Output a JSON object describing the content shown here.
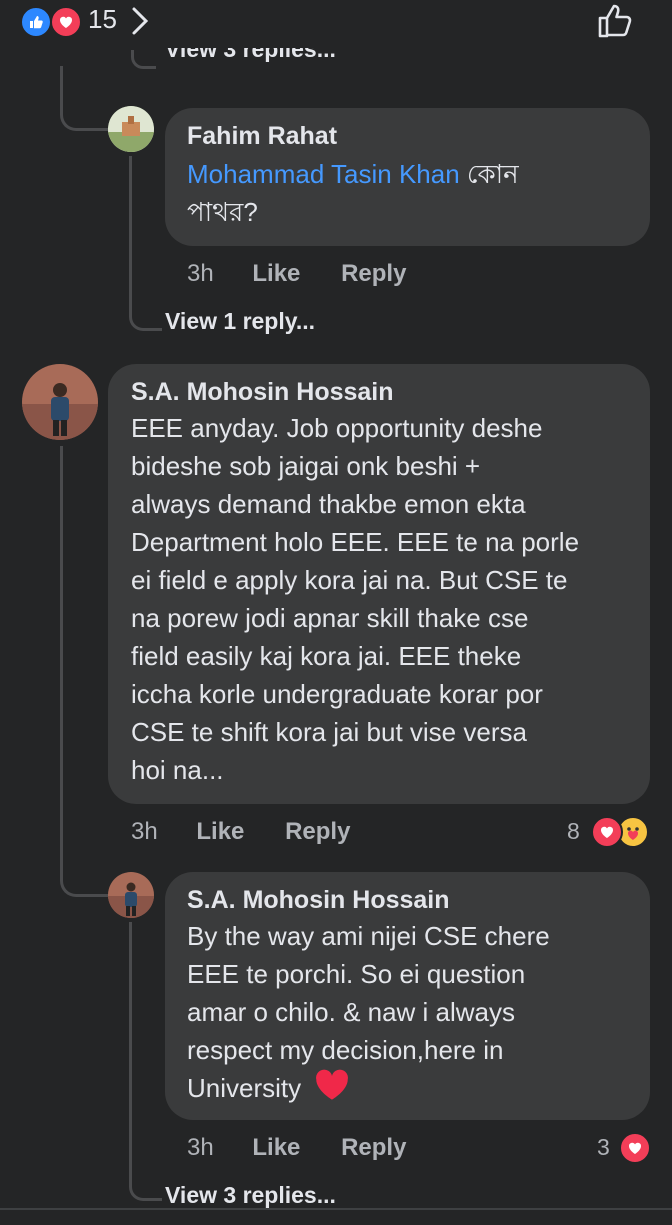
{
  "reactions": {
    "count": "15"
  },
  "top_thread": {
    "view_replies": "View 3 replies..."
  },
  "comments": [
    {
      "author": "Fahim Rahat",
      "mention": "Mohammad Tasin Khan",
      "text_line1": " কোন",
      "text_line2": "পাথর?",
      "time": "3h",
      "like": "Like",
      "reply": "Reply",
      "view_replies": "View 1 reply..."
    },
    {
      "author": "S.A. Mohosin Hossain",
      "lines": [
        "EEE anyday. Job opportunity deshe",
        "bideshe sob jaigai onk beshi +",
        "always demand thakbe emon ekta",
        "Department holo EEE. EEE te na porle",
        "ei field e apply kora jai na. But CSE te",
        "na porew jodi apnar skill thake cse",
        "field easily kaj kora jai. EEE theke",
        "iccha korle undergraduate korar por",
        "CSE te shift kora jai but vise versa",
        "hoi na..."
      ],
      "time": "3h",
      "like": "Like",
      "reply": "Reply",
      "reaction_count": "8"
    },
    {
      "author": "S.A. Mohosin Hossain",
      "lines": [
        "By the way ami nijei CSE chere",
        "EEE te porchi. So ei question",
        "amar o chilo. & naw i always",
        "respect my decision,here in",
        "University"
      ],
      "time": "3h",
      "like": "Like",
      "reply": "Reply",
      "reaction_count": "3",
      "view_replies": "View 3 replies..."
    }
  ],
  "colors": {
    "background": "#242526",
    "bubble": "#3a3b3c",
    "mention": "#4599ff",
    "like_blue": "#2d88ff",
    "love_red": "#f33e58"
  }
}
